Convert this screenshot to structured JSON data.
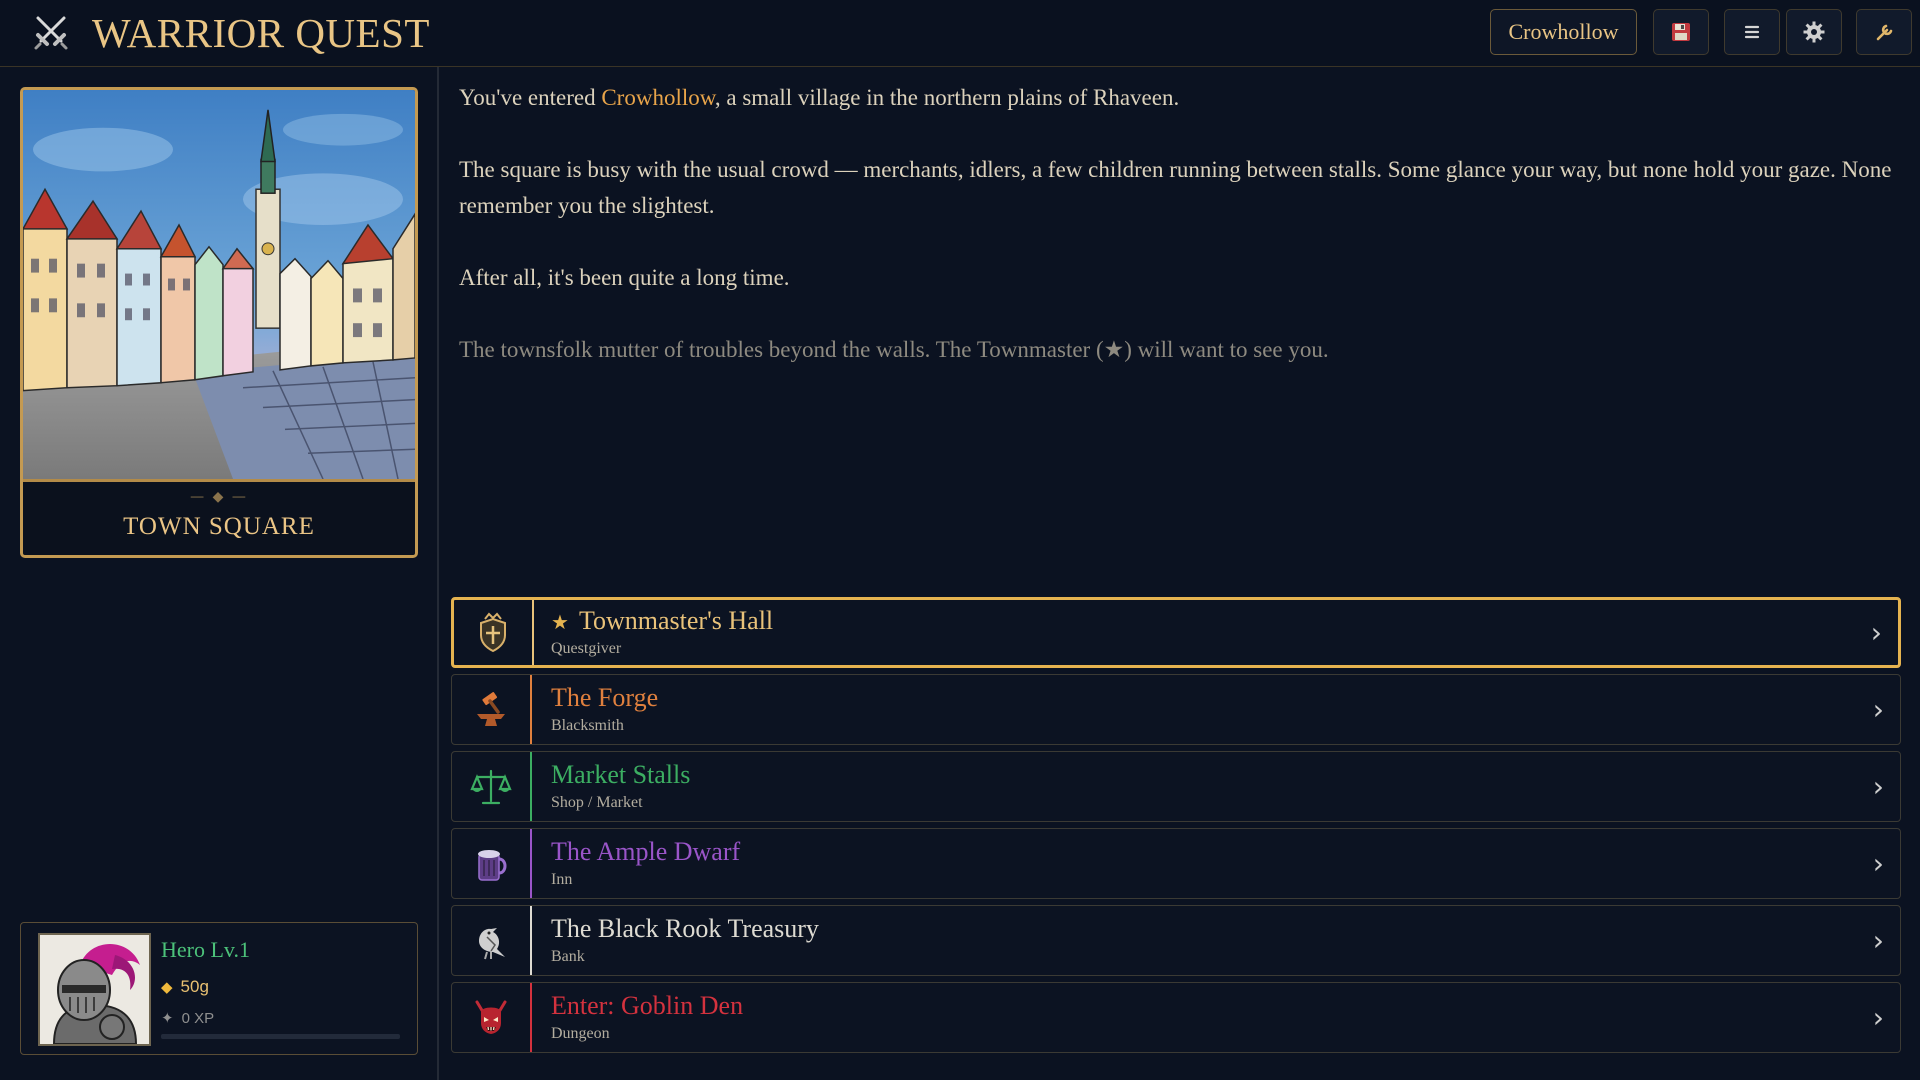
{
  "header": {
    "title": "WARRIOR QUEST",
    "location_button": "Crowhollow",
    "tools": [
      {
        "icon": "save-icon"
      },
      {
        "icon": "menu-icon"
      },
      {
        "icon": "gear-icon"
      },
      {
        "icon": "wrench-icon"
      }
    ]
  },
  "scene": {
    "ornament": "— ◆ —",
    "name": "TOWN SQUARE"
  },
  "narrative": {
    "p1_before": "You've entered ",
    "p1_place": "Crowhollow",
    "p1_after": ", a small village in the northern plains of Rhaveen.",
    "p2": "The square is busy with the usual crowd — merchants, idlers, a few children running between stalls. Some glance your way, but none hold your gaze. None remember you the slightest.",
    "p3": "After all, it's been quite a long time.",
    "hint": "The townsfolk mutter of troubles beyond the walls. The Townmaster (★) will want to see you."
  },
  "destinations": [
    {
      "name": "Townmaster's Hall",
      "sub": "Questgiver",
      "star": "★",
      "accent": "#e9c27a",
      "icon": "crest-shield-icon",
      "featured": true
    },
    {
      "name": "The Forge",
      "sub": "Blacksmith",
      "accent": "#e0803e",
      "icon": "anvil-hammer-icon"
    },
    {
      "name": "Market Stalls",
      "sub": "Shop / Market",
      "accent": "#3cae62",
      "icon": "scales-icon"
    },
    {
      "name": "The Ample Dwarf",
      "sub": "Inn",
      "accent": "#9a55c9",
      "icon": "tankard-icon"
    },
    {
      "name": "The Black Rook Treasury",
      "sub": "Bank",
      "accent": "#dedbd2",
      "icon": "rook-bird-icon"
    },
    {
      "name": "Enter: Goblin Den",
      "sub": "Dungeon",
      "accent": "#d4323e",
      "icon": "demon-skull-icon"
    }
  ],
  "chevron": "›",
  "hero": {
    "name": "Hero  Lv.1",
    "gold_icon": "◆",
    "gold": "50g",
    "xp_icon": "✦",
    "xp": "0 XP",
    "xp_progress": 0
  }
}
